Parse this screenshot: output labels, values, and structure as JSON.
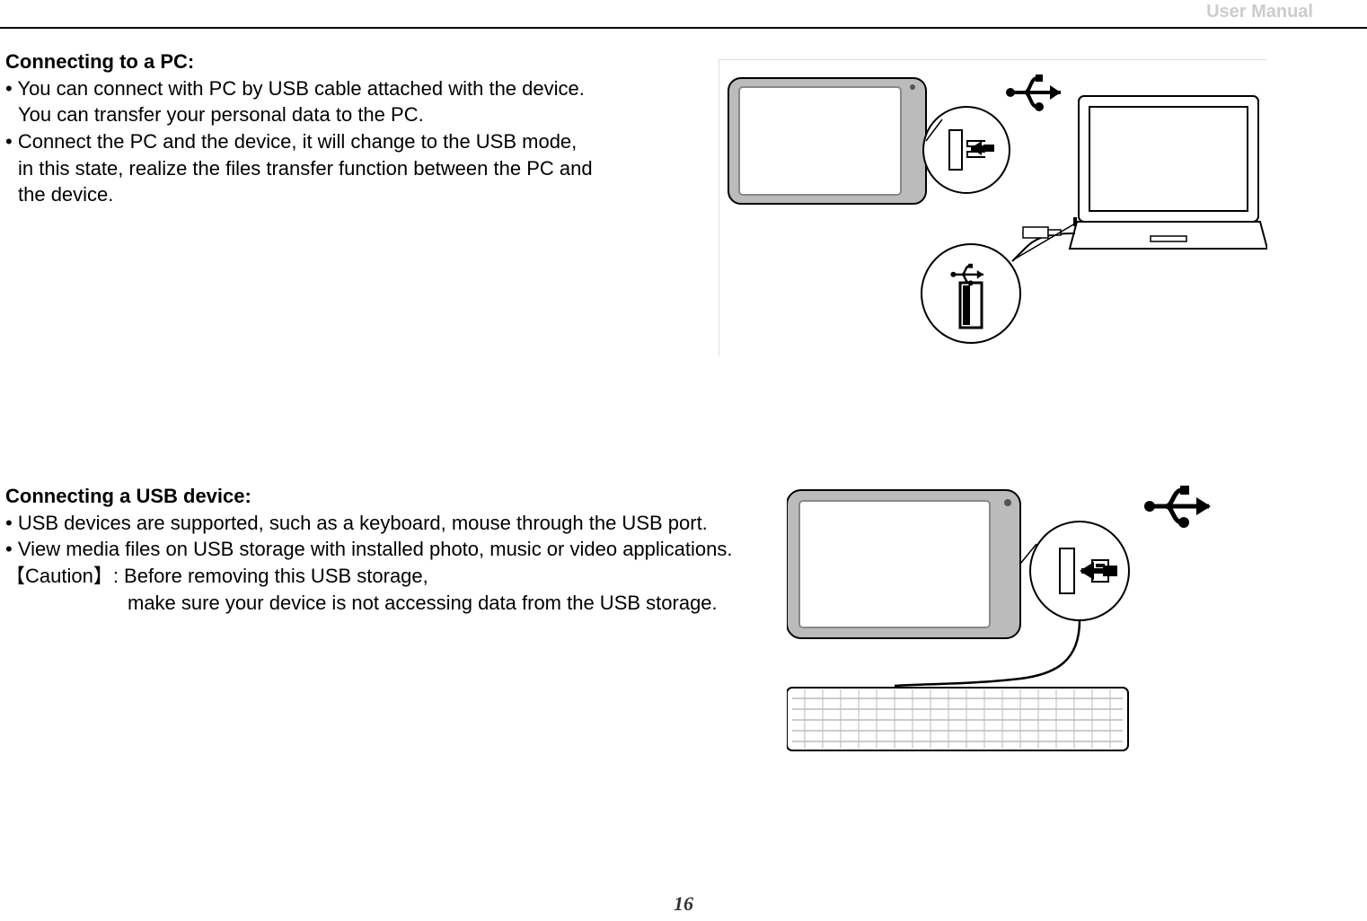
{
  "header": {
    "label": "User Manual"
  },
  "page_number": "16",
  "section1": {
    "heading": "Connecting to a PC:",
    "b1a": "• You can connect with PC by USB cable attached with the device.",
    "b1b": "You can transfer your personal data to the PC.",
    "b2a": "• Connect the PC and the device, it will change to the USB mode,",
    "b2b": "in this state, realize the files transfer function between the PC and",
    "b2c": "the device."
  },
  "section2": {
    "heading": "Connecting a USB device:",
    "b1": "• USB devices are supported, such as a keyboard, mouse through the USB port.",
    "b2": "• View media files on USB storage with installed photo, music or video applications.",
    "caution_a": "【Caution】: Before removing this USB storage,",
    "caution_b": "make sure your device is not accessing data from the USB storage."
  }
}
